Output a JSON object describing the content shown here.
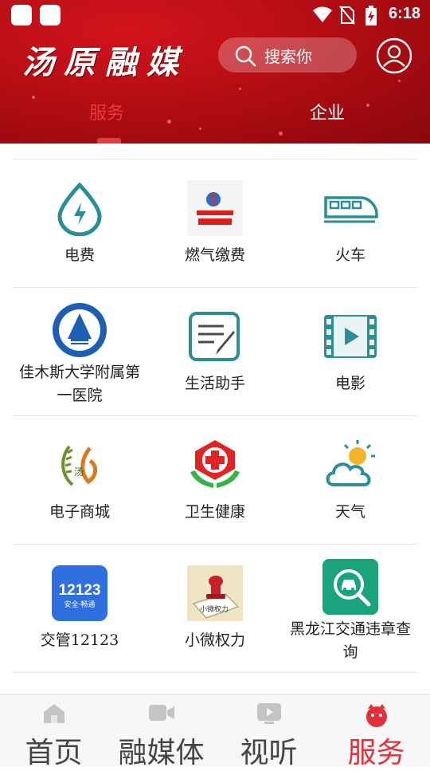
{
  "status_bar": {
    "time": "6:18"
  },
  "header": {
    "app_title": "汤原融媒",
    "search_placeholder": "搜索你",
    "tabs": [
      {
        "label": "服务",
        "active": true
      },
      {
        "label": "企业",
        "active": false
      }
    ]
  },
  "services": [
    {
      "label": "电费",
      "icon": "electricity-drop-icon"
    },
    {
      "label": "燃气缴费",
      "icon": "china-gas-logo"
    },
    {
      "label": "火车",
      "icon": "train-icon"
    },
    {
      "label": "佳木斯大学附属第一医院",
      "icon": "hospital-emblem-icon"
    },
    {
      "label": "生活助手",
      "icon": "notepad-pen-icon"
    },
    {
      "label": "电影",
      "icon": "film-play-icon"
    },
    {
      "label": "电子商城",
      "icon": "mall-logo-icon"
    },
    {
      "label": "卫生健康",
      "icon": "health-cross-icon"
    },
    {
      "label": "天气",
      "icon": "weather-sun-cloud-icon"
    },
    {
      "label": "交管12123",
      "icon": "traffic-12123-icon",
      "icon_text": "12123",
      "icon_subtext": "安全·畅通"
    },
    {
      "label": "小微权力",
      "icon": "stamp-icon",
      "icon_text": "小微权力"
    },
    {
      "label": "黑龙江交通违章查询",
      "icon": "car-search-icon"
    }
  ],
  "bottom_nav": [
    {
      "label": "首页",
      "icon": "home-icon",
      "active": false
    },
    {
      "label": "融媒体",
      "icon": "video-camera-icon",
      "active": false
    },
    {
      "label": "视听",
      "icon": "play-screen-icon",
      "active": false
    },
    {
      "label": "服务",
      "icon": "service-face-icon",
      "active": true
    }
  ],
  "colors": {
    "brand_red": "#c8101a",
    "active_red": "#e0313a",
    "teal": "#2a8e99"
  }
}
